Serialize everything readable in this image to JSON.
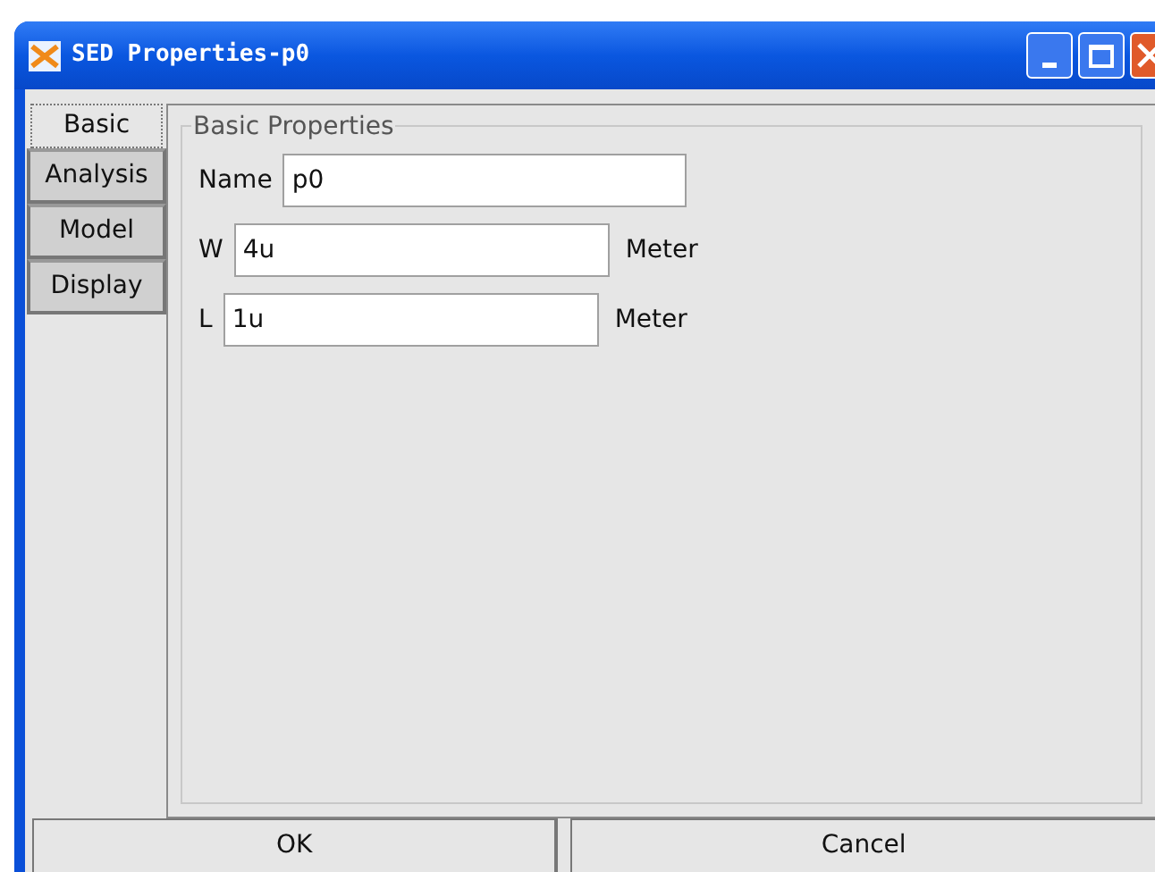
{
  "window": {
    "title": "SED Properties-p0"
  },
  "tabs": [
    {
      "label": "Basic",
      "selected": true
    },
    {
      "label": "Analysis",
      "selected": false
    },
    {
      "label": "Model",
      "selected": false
    },
    {
      "label": "Display",
      "selected": false
    }
  ],
  "group": {
    "title": "Basic Properties"
  },
  "fields": [
    {
      "label": "Name",
      "value": "p0"
    },
    {
      "label": "W",
      "value": "4u",
      "unit": "Meter"
    },
    {
      "label": "L",
      "value": "1u",
      "unit": "Meter"
    }
  ],
  "buttons": [
    "OK",
    "Cancel"
  ]
}
